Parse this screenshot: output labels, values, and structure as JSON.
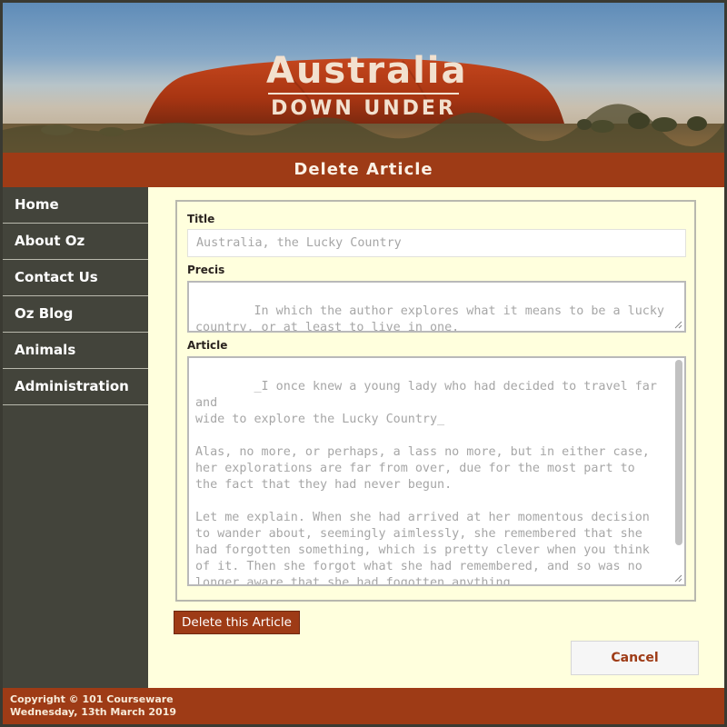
{
  "banner": {
    "title": "Australia",
    "subtitle": "DOWN UNDER"
  },
  "page": {
    "heading": "Delete Article"
  },
  "sidebar": {
    "items": [
      {
        "label": "Home"
      },
      {
        "label": "About Oz"
      },
      {
        "label": "Contact Us"
      },
      {
        "label": "Oz Blog"
      },
      {
        "label": "Animals"
      },
      {
        "label": "Administration"
      }
    ]
  },
  "form": {
    "title_label": "Title",
    "title_value": "Australia, the Lucky Country",
    "precis_label": "Precis",
    "precis_value": "In which the author explores what it means to be a lucky\ncountry, or at least to live in one.",
    "article_label": "Article",
    "article_value": "_I once knew a young lady who had decided to travel far and\nwide to explore the Lucky Country_\n\nAlas, no more, or perhaps, a lass no more, but in either case,\nher explorations are far from over, due for the most part to\nthe fact that they had never begun.\n\nLet me explain. When she had arrived at her momentous decision\nto wander about, seemingly aimlessly, she remembered that she\nhad forgotten something, which is pretty clever when you think\nof it. Then she forgot what she had remembered, and so was no\nlonger aware that she had fogotten anything.\n\nUnfortunately, in the process she also forgot to explore the",
    "delete_button": "Delete this Article",
    "cancel_button": "Cancel"
  },
  "footer": {
    "copyright": "Copyright © 101 Courseware",
    "date": "Wednesday, 13th March 2019"
  },
  "colors": {
    "brand": "#9e3b16",
    "sidebar": "#43443b",
    "content_bg": "#ffffdd"
  }
}
